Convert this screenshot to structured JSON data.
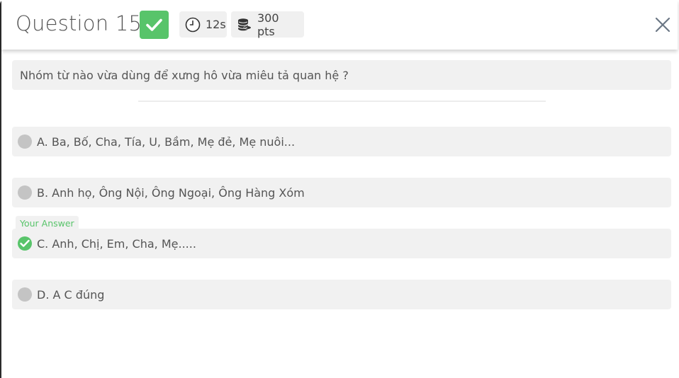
{
  "header": {
    "title": "Question 15",
    "time": "12s",
    "points": "300 pts"
  },
  "question": {
    "text": "Nhóm từ nào vừa dùng để xưng hô vừa miêu tả quan hệ ?"
  },
  "answer_tag": "Your Answer",
  "options": [
    {
      "label": "A. Ba, Bố, Cha, Tía, U, Bầm, Mẹ đẻ, Mẹ nuôi...",
      "selected": false
    },
    {
      "label": "B. Anh họ, Ông Nội, Ông Ngoại, Ông Hàng Xóm",
      "selected": false
    },
    {
      "label": "C. Anh, Chị, Em, Cha, Mẹ.....",
      "selected": true
    },
    {
      "label": "D. A C đúng",
      "selected": false
    }
  ],
  "colors": {
    "correct_green": "#58c46a",
    "option_bg": "#f1f1f1",
    "dot_gray": "#c4c4c4"
  },
  "icons": {
    "correct": "check-icon",
    "timer": "clock-icon",
    "points": "coins-icon",
    "close": "close-icon"
  }
}
